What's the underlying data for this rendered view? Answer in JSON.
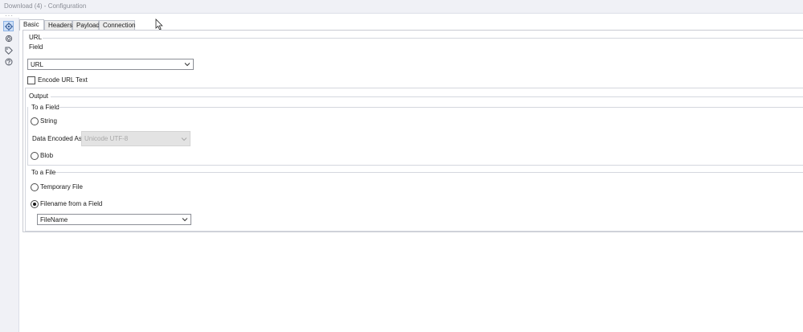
{
  "window": {
    "title": "Download (4) - Configuration"
  },
  "sidebar": {
    "icons": [
      "gear-icon",
      "refresh-icon",
      "tag-icon",
      "help-icon"
    ]
  },
  "tabs": [
    {
      "label": "Basic",
      "active": true
    },
    {
      "label": "Headers",
      "active": false
    },
    {
      "label": "Payload",
      "active": false
    },
    {
      "label": "Connection",
      "active": false
    }
  ],
  "url_section": {
    "heading": "URL",
    "field_label": "Field",
    "field_value": "URL",
    "encode_label": "Encode URL Text",
    "encode_checked": false
  },
  "output": {
    "heading": "Output",
    "to_field": {
      "heading": "To a Field",
      "string_label": "String",
      "string_checked": false,
      "encoded_as_label": "Data Encoded As",
      "encoded_as_value": "Unicode UTF-8",
      "blob_label": "Blob",
      "blob_checked": false
    },
    "to_file": {
      "heading": "To a File",
      "temp_label": "Temporary File",
      "temp_checked": false,
      "filename_label": "Filename from a Field",
      "filename_checked": true,
      "filename_value": "FileName"
    }
  }
}
